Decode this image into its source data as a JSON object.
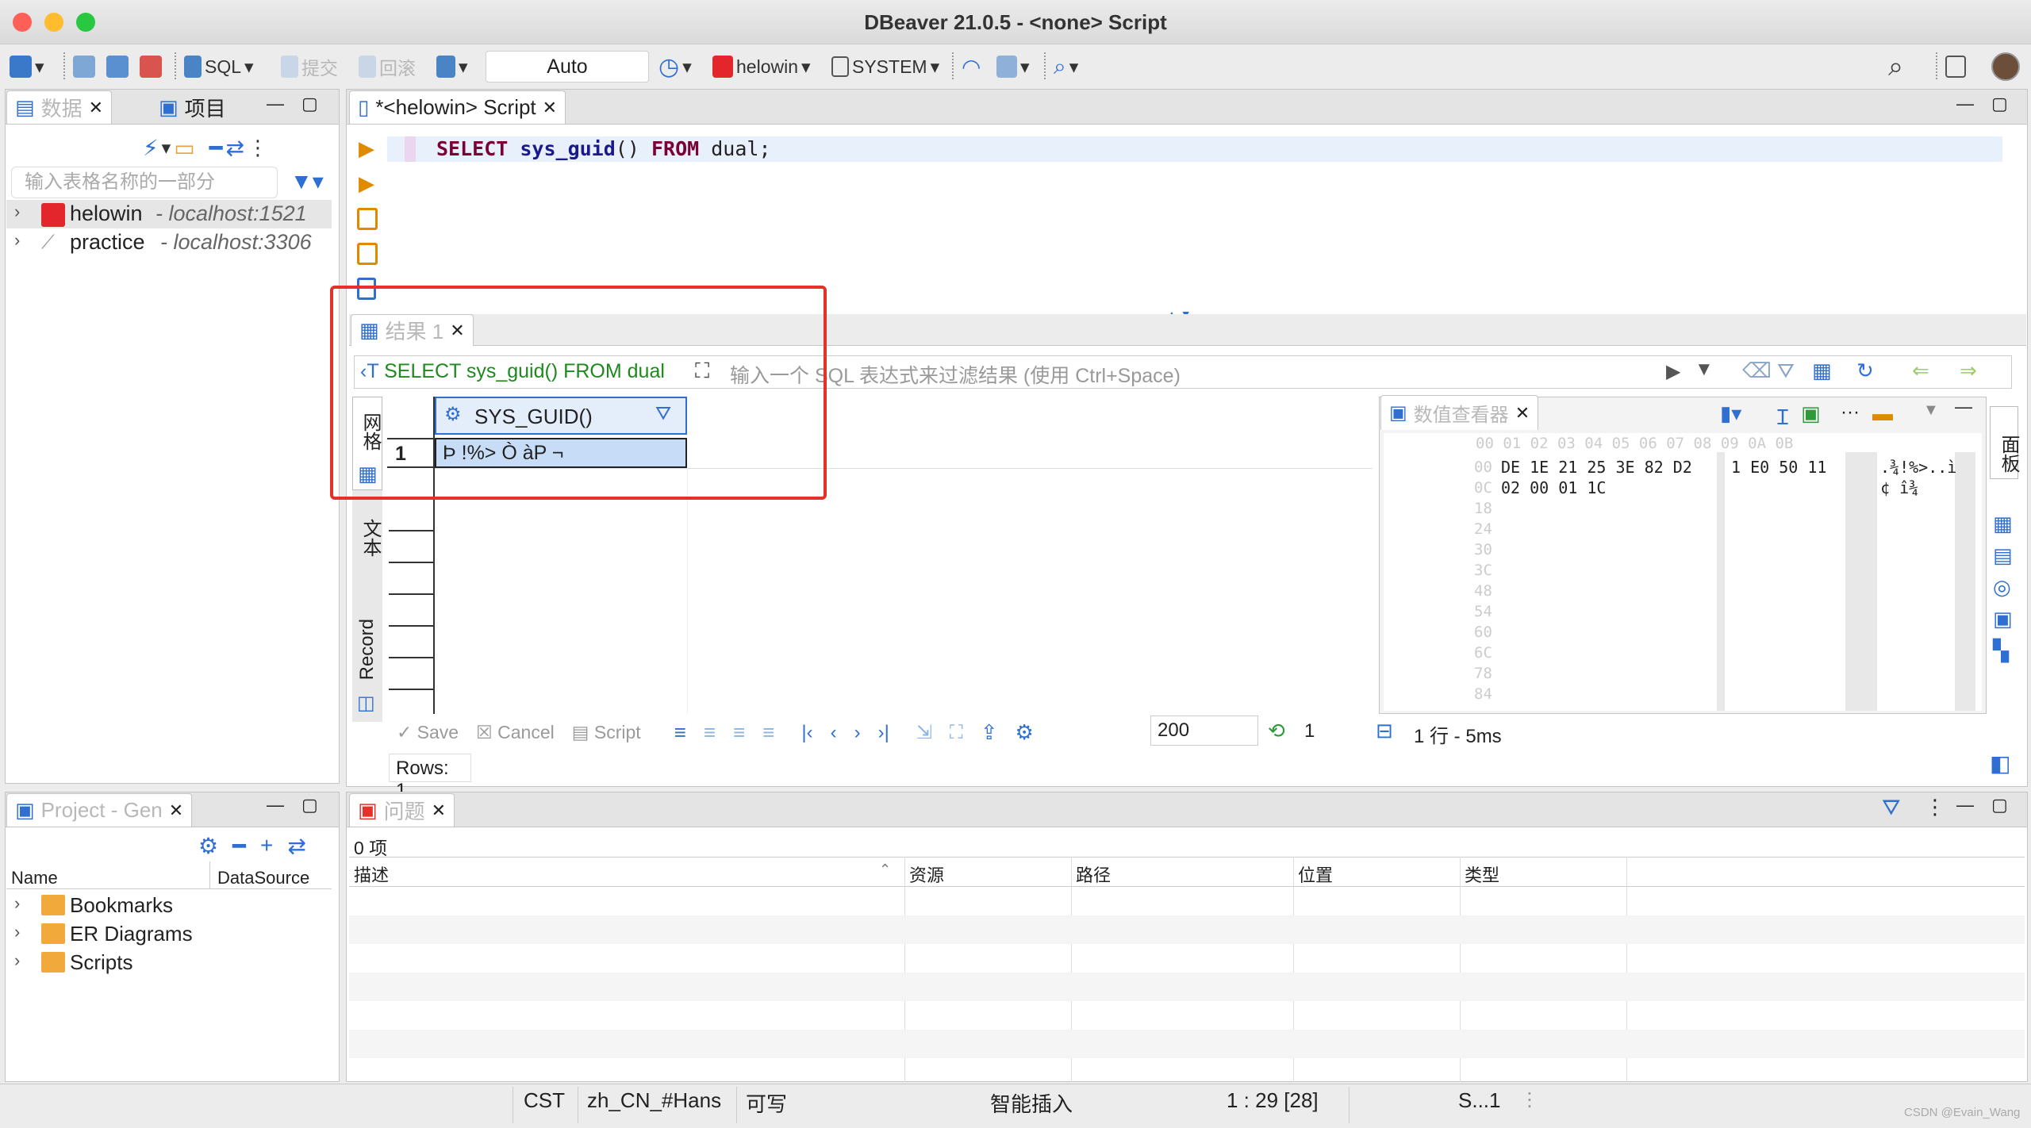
{
  "window": {
    "title": "DBeaver 21.0.5 - <none> Script"
  },
  "toolbar": {
    "sql_label": "SQL",
    "commit_label": "提交",
    "rollback_label": "回滚",
    "transaction_mode": "Auto",
    "connection": "helowin",
    "schema": "SYSTEM"
  },
  "navigator": {
    "tab_data": "数据",
    "tab_project": "项目",
    "filter_placeholder": "输入表格名称的一部分",
    "connections": [
      {
        "name": "helowin",
        "host": "- localhost:1521"
      },
      {
        "name": "practice",
        "host": "- localhost:3306"
      }
    ]
  },
  "editor": {
    "tab_title": "*<helowin> Script",
    "sql_keyword1": "SELECT",
    "sql_function": "sys_guid",
    "sql_paren": "()",
    "sql_keyword2": "FROM",
    "sql_rest": "dual;"
  },
  "results": {
    "tab_title": "结果 1",
    "query_text": "SELECT sys_guid() FROM dual",
    "filter_placeholder": "输入一个 SQL 表达式来过滤结果 (使用 Ctrl+Space)",
    "side_tabs": [
      "网格",
      "文本",
      "Record"
    ],
    "column_header": "SYS_GUID()",
    "rows": [
      {
        "num": "1",
        "value": "Þ !%> Ò àP ¬"
      }
    ],
    "buttons": {
      "save": "Save",
      "cancel": "Cancel",
      "script": "Script"
    },
    "fetch_size": "200",
    "refresh_count": "1",
    "row_info": "1 行 - 5ms",
    "rows_count": "Rows: 1"
  },
  "value_viewer": {
    "tab_title": "数值查看器",
    "side_label": "面板",
    "header_offsets": "00 01 02 03 04 05 06 07 08 09 0A 0B",
    "row_offsets": [
      "00",
      "0C",
      "18",
      "24",
      "30",
      "3C",
      "48",
      "54",
      "60",
      "6C",
      "78",
      "84"
    ],
    "hex_lines": [
      "DE 1E 21 25 3E 82 D2",
      "02 00 01 1C"
    ],
    "hex_lines_b": [
      "1 E0 50 11",
      ""
    ],
    "ascii_lines": [
      ".¾!%>..ì",
      "¢ î¾"
    ]
  },
  "project_panel": {
    "tab_title": "Project - Gen",
    "col_name": "Name",
    "col_datasource": "DataSource",
    "items": [
      "Bookmarks",
      "ER Diagrams",
      "Scripts"
    ]
  },
  "problems": {
    "tab_title": "问题",
    "count": "0 项",
    "columns": [
      "描述",
      "资源",
      "路径",
      "位置",
      "类型"
    ]
  },
  "statusbar": {
    "timezone": "CST",
    "locale": "zh_CN_#Hans",
    "mode": "可写",
    "insert": "智能插入",
    "position": "1 : 29 [28]",
    "extra": "S...1"
  },
  "watermark": "CSDN @Evain_Wang",
  "colors": {
    "accent": "#2f6fd1",
    "redbox": "#e6302a",
    "selection": "#c7dcf7"
  }
}
